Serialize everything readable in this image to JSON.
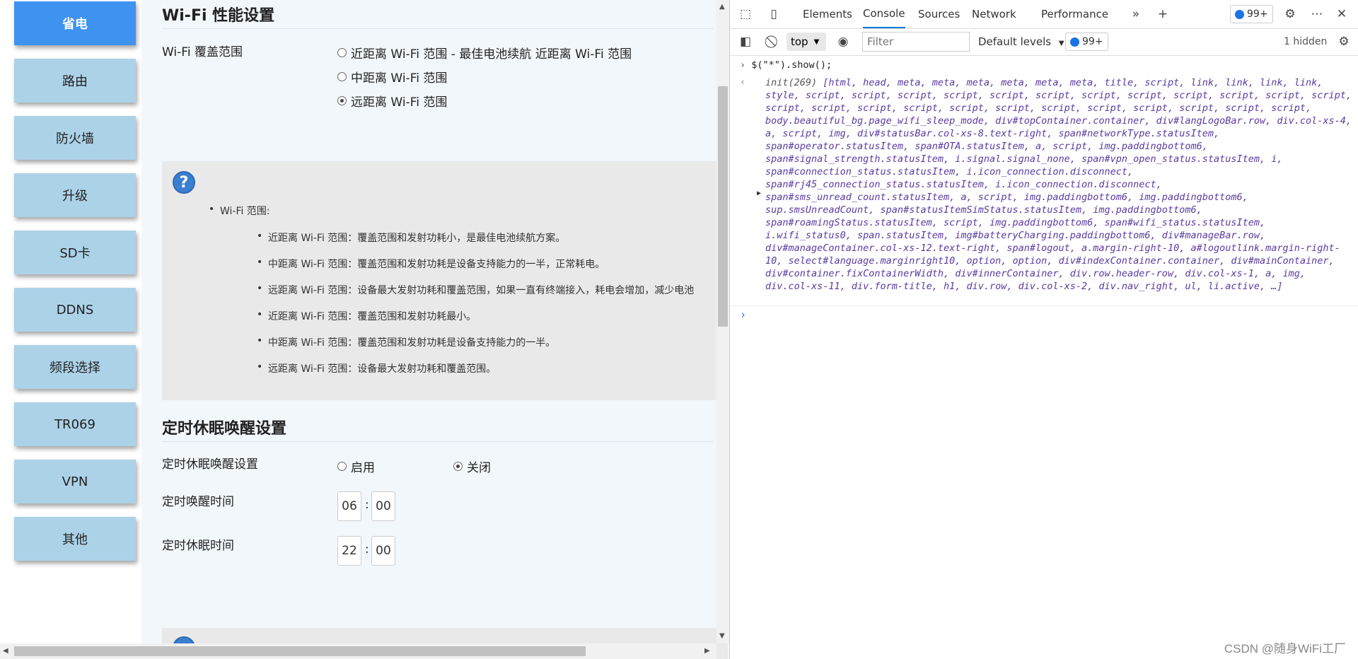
{
  "sidebar": {
    "items": [
      "省电",
      "路由",
      "防火墙",
      "升级",
      "SD卡",
      "DDNS",
      "频段选择",
      "TR069",
      "VPN",
      "其他"
    ],
    "active_index": 0
  },
  "wifi_perf": {
    "title": "Wi-Fi 性能设置",
    "coverage_label": "Wi-Fi 覆盖范围",
    "options": [
      "近距离 Wi-Fi 范围 - 最佳电池续航 近距离 Wi-Fi 范围",
      "中距离 Wi-Fi 范围",
      "远距离 Wi-Fi 范围"
    ],
    "selected": 2
  },
  "help1": {
    "icon": "?",
    "title": "Wi-Fi 范围:",
    "items": [
      "近距离 Wi-Fi 范围：覆盖范围和发射功耗小，是最佳电池续航方案。",
      "中距离 Wi-Fi 范围：覆盖范围和发射功耗是设备支持能力的一半，正常耗电。",
      "远距离 Wi-Fi 范围：设备最大发射功耗和覆盖范围，如果一直有终端接入，耗电会增加，减少电池",
      "近距离 Wi-Fi 范围：覆盖范围和发射功耗最小。",
      "中距离 Wi-Fi 范围：覆盖范围和发射功耗是设备支持能力的一半。",
      "远距离 Wi-Fi 范围：设备最大发射功耗和覆盖范围。"
    ]
  },
  "sleep": {
    "title": "定时休眠唤醒设置",
    "setting_label": "定时休眠唤醒设置",
    "enable_label": "启用",
    "disable_label": "关闭",
    "selected": "disable",
    "wake_label": "定时唤醒时间",
    "wake_hour": "06",
    "wake_min": "00",
    "sleep_label": "定时休眠时间",
    "sleep_hour": "22",
    "sleep_min": "00",
    "colon": ":"
  },
  "devtools": {
    "tabs": [
      "Elements",
      "Console",
      "Sources",
      "Network",
      "Performance"
    ],
    "active_tab": "Console",
    "badge_count": "99+",
    "context": "top",
    "filter_placeholder": "Filter",
    "levels": "Default levels",
    "hidden": "1 hidden",
    "command": "$(\"*\").show();",
    "output_prefix": "init(269) ",
    "output_text": "[html, head, meta, meta, meta, meta, meta, meta, title, script, link, link, link, link, style, script, script, script, script, script, script, script, script, script, script, script, script, script, script, script, script, script, script, script, script, script, script, script, script, body.beautiful_bg.page_wifi_sleep_mode, div#topContainer.container, div#langLogoBar.row, div.col-xs-4, a, script, img, div#statusBar.col-xs-8.text-right, span#networkType.statusItem, span#operator.statusItem, span#OTA.statusItem, a, script, img.paddingbottom6, span#signal_strength.statusItem, i.signal.signal_none, span#vpn_open_status.statusItem, i, span#connection_status.statusItem, i.icon_connection.disconnect, span#rj45_connection_status.statusItem, i.icon_connection.disconnect, span#sms_unread_count.statusItem, a, script, img.paddingbottom6, img.paddingbottom6, sup.smsUnreadCount, span#statusItemSimStatus.statusItem, img.paddingbottom6, span#roamingStatus.statusItem, script, img.paddingbottom6, span#wifi_status.statusItem, i.wifi_status0, span.statusItem, img#batteryCharging.paddingbottom6, div#manageBar.row, div#manageContainer.col-xs-12.text-right, span#logout, a.margin-right-10, a#logoutlink.margin-right-10, select#language.marginright10, option, option, div#indexContainer.container, div#mainContainer, div#container.fixContainerWidth, div#innerContainer, div.row.header-row, div.col-xs-1, a, img, div.col-xs-11, div.form-title, h1, div.row, div.col-xs-2, div.nav_right, ul, li.active, …]"
  },
  "watermark": "CSDN @随身WiFi工厂"
}
